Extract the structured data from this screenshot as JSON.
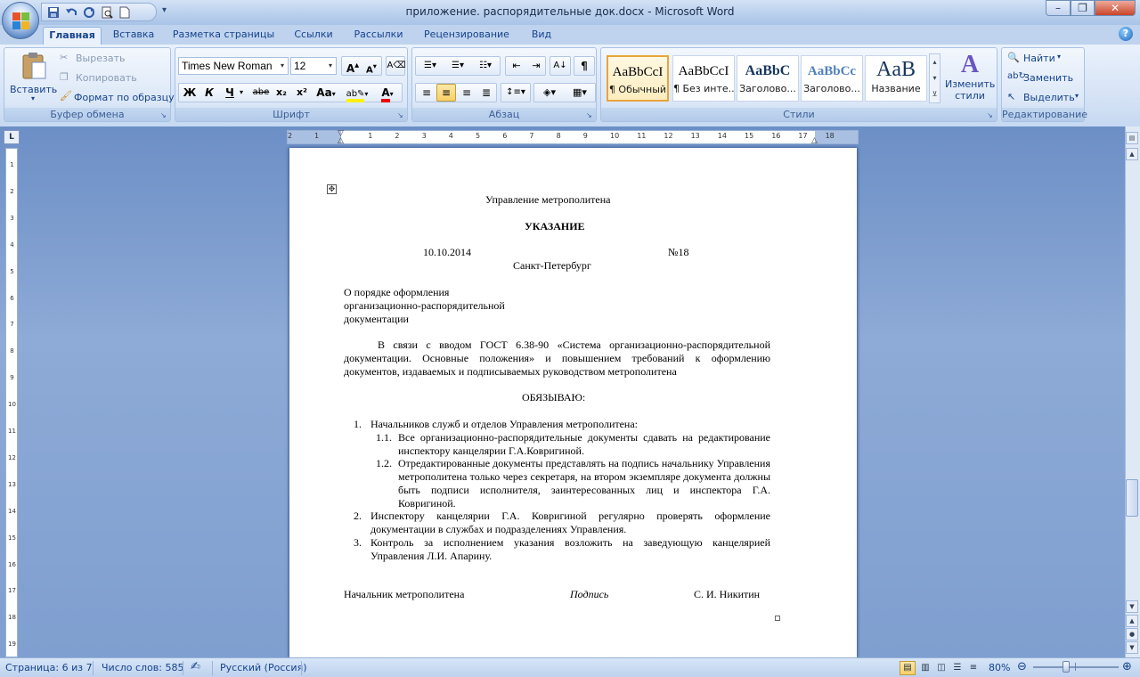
{
  "window": {
    "title": "приложение. распорядительные док.docx - Microsoft Word",
    "controls": [
      "minimize",
      "restore",
      "close"
    ]
  },
  "qat": {
    "icons": [
      "save-icon",
      "undo-icon",
      "redo-icon",
      "print-preview-icon",
      "new-document-icon"
    ]
  },
  "tabs": [
    "Главная",
    "Вставка",
    "Разметка страницы",
    "Ссылки",
    "Рассылки",
    "Рецензирование",
    "Вид"
  ],
  "active_tab": "Главная",
  "ribbon": {
    "clipboard": {
      "label": "Буфер обмена",
      "paste": "Вставить",
      "cut": "Вырезать",
      "copy": "Копировать",
      "format_painter": "Формат по образцу"
    },
    "font": {
      "label": "Шрифт",
      "font_name": "Times New Roman",
      "font_size": "12",
      "bold": "Ж",
      "italic": "К",
      "underline": "Ч",
      "strike": "abe",
      "subscript": "x₂",
      "superscript": "x²",
      "change_case": "Aa"
    },
    "paragraph": {
      "label": "Абзац"
    },
    "styles": {
      "label": "Стили",
      "items": [
        {
          "preview": "AaBbCcI",
          "name": "¶ Обычный"
        },
        {
          "preview": "AaBbCcI",
          "name": "¶ Без инте..."
        },
        {
          "preview": "AaBbC",
          "name": "Заголово..."
        },
        {
          "preview": "AaBbCc",
          "name": "Заголово..."
        },
        {
          "preview": "AaB",
          "name": "Название"
        }
      ],
      "change_styles": "Изменить стили"
    },
    "editing": {
      "label": "Редактирование",
      "find": "Найти",
      "replace": "Заменить",
      "select": "Выделить"
    }
  },
  "ruler": {
    "h_numbers": [
      "2",
      "1",
      "1",
      "2",
      "3",
      "4",
      "5",
      "6",
      "7",
      "8",
      "9",
      "10",
      "11",
      "12",
      "13",
      "14",
      "15",
      "16",
      "17",
      "18"
    ],
    "v_numbers": [
      "1",
      "2",
      "3",
      "4",
      "5",
      "6",
      "7",
      "8",
      "9",
      "10",
      "11",
      "12",
      "13",
      "14",
      "15",
      "16",
      "17",
      "18",
      "19"
    ]
  },
  "document": {
    "org": "Управление метрополитена",
    "doc_type": "УКАЗАНИЕ",
    "date": "10.10.2014",
    "number": "№18",
    "city": "Санкт-Петербург",
    "subject": [
      "О порядке оформления",
      "организационно-распорядительной",
      "документации"
    ],
    "preamble": "В связи с вводом ГОСТ 6.38-90 «Система организационно-распорядительной документации. Основные положения» и повышением требований к оформлению документов, издаваемых и подписываемых руководством метрополитена",
    "oblige": "ОБЯЗЫВАЮ:",
    "items": [
      {
        "num": "1.",
        "text": "Начальников служб и отделов Управления метрополитена:"
      },
      {
        "num": "1.1.",
        "text": "Все организационно-распорядительные документы сдавать на редактирование инспектору канцелярии Г.А.Ковригиной."
      },
      {
        "num": "1.2.",
        "text": "Отредактированные документы представлять на подпись начальнику Управления метрополитена только через секретаря, на втором экземпляре документа должны быть подписи исполнителя, заинтересованных лиц и инспектора Г.А. Ковригиной."
      },
      {
        "num": "2.",
        "text": "Инспектору канцелярии Г.А. Ковригиной регулярно проверять оформление документации в службах и подразделениях Управления."
      },
      {
        "num": "3.",
        "text": "Контроль за исполнением указания возложить на заведующую канцелярией Управления Л.И. Апарину."
      }
    ],
    "sign_position": "Начальник метрополитена",
    "sign_label": "Подпись",
    "sign_name": "С. И. Никитин"
  },
  "status": {
    "page": "Страница: 6 из 7",
    "words": "Число слов: 585",
    "language": "Русский (Россия)",
    "zoom": "80%",
    "zoom_level": 80
  }
}
